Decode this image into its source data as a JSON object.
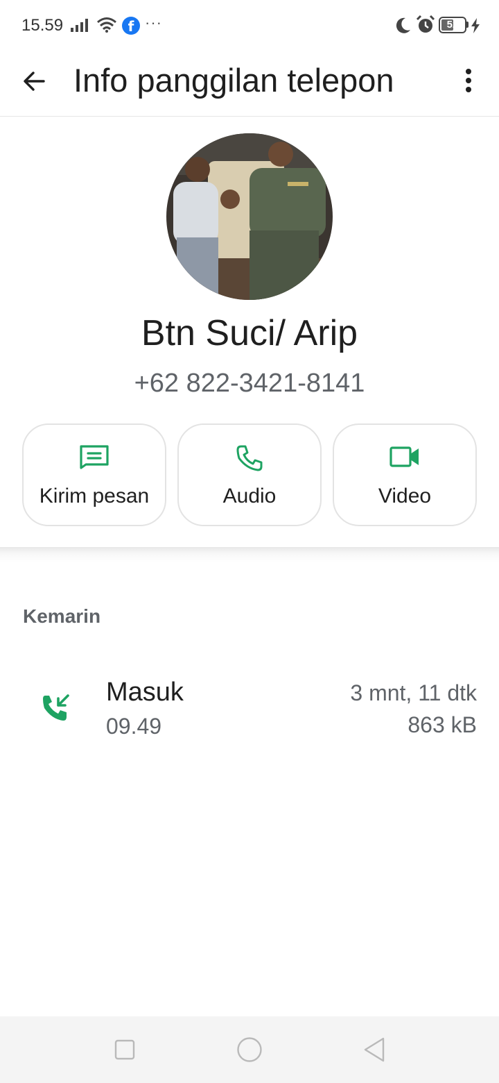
{
  "status_bar": {
    "time": "15.59",
    "battery_percent": "52",
    "battery_level": 0.52,
    "icons": [
      "signal-icon",
      "wifi-icon",
      "facebook-icon",
      "more-notifications-icon",
      "moon-icon",
      "alarm-icon",
      "battery-icon",
      "charging-icon"
    ]
  },
  "app_bar": {
    "title": "Info panggilan telepon",
    "back_icon": "arrow-back-icon",
    "menu_icon": "more-vert-icon"
  },
  "contact": {
    "name": "Btn Suci/ Arip",
    "phone": "+62 822-3421-8141"
  },
  "actions": [
    {
      "label": "Kirim pesan",
      "icon": "message-icon"
    },
    {
      "label": "Audio",
      "icon": "phone-icon"
    },
    {
      "label": "Video",
      "icon": "videocam-icon"
    }
  ],
  "history": {
    "section_label": "Kemarin",
    "calls": [
      {
        "type": "Masuk",
        "time": "09.49",
        "duration": "3 mnt, 11 dtk",
        "size": "863 kB",
        "icon": "incoming-call-icon"
      }
    ]
  },
  "colors": {
    "accent_green": "#1ea362",
    "text_primary": "#1f1f1f",
    "text_secondary": "#5f6368",
    "facebook_blue": "#1877f2"
  },
  "nav_bar": {
    "buttons": [
      "recents-icon",
      "home-icon",
      "back-triangle-icon"
    ]
  }
}
